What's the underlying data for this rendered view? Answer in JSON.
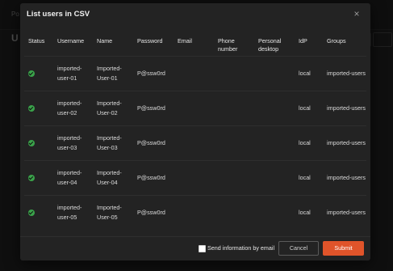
{
  "background": {
    "breadcrumb": "Po",
    "page_title": "U"
  },
  "modal": {
    "title": "List users in CSV",
    "close_glyph": "×",
    "columns": [
      "Status",
      "Username",
      "Name",
      "Password",
      "Email",
      "Phone number",
      "Personal desktop",
      "IdP",
      "Groups"
    ],
    "rows": [
      {
        "status": "success",
        "username": "imported-user-01",
        "name": "Imported-User-01",
        "password": "P@ssw0rd",
        "email": "",
        "phone": "",
        "desktop": "",
        "idp": "local",
        "groups": "imported-users"
      },
      {
        "status": "success",
        "username": "imported-user-02",
        "name": "Imported-User-02",
        "password": "P@ssw0rd",
        "email": "",
        "phone": "",
        "desktop": "",
        "idp": "local",
        "groups": "imported-users"
      },
      {
        "status": "success",
        "username": "imported-user-03",
        "name": "Imported-User-03",
        "password": "P@ssw0rd",
        "email": "",
        "phone": "",
        "desktop": "",
        "idp": "local",
        "groups": "imported-users"
      },
      {
        "status": "success",
        "username": "imported-user-04",
        "name": "Imported-User-04",
        "password": "P@ssw0rd",
        "email": "",
        "phone": "",
        "desktop": "",
        "idp": "local",
        "groups": "imported-users"
      },
      {
        "status": "success",
        "username": "imported-user-05",
        "name": "Imported-User-05",
        "password": "P@ssw0rd",
        "email": "",
        "phone": "",
        "desktop": "",
        "idp": "local",
        "groups": "imported-users"
      }
    ],
    "footer": {
      "send_info_label": "Send information by email",
      "send_info_checked": false,
      "cancel_label": "Cancel",
      "submit_label": "Submit"
    }
  },
  "colors": {
    "accent": "#e0542a",
    "success": "#3aa24a",
    "modal_bg": "#232323"
  }
}
